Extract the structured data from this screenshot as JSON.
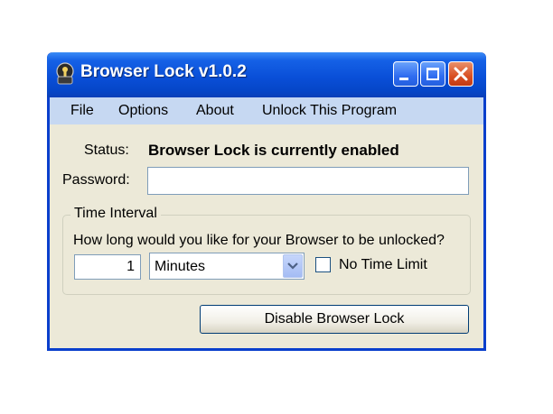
{
  "window": {
    "title": "Browser Lock v1.0.2",
    "icons": {
      "app": "lock-app-icon",
      "minimize": "minimize-icon",
      "maximize": "maximize-icon",
      "close": "close-icon"
    }
  },
  "menu": {
    "items": [
      {
        "label": "File"
      },
      {
        "label": "Options"
      },
      {
        "label": "About"
      },
      {
        "label": "Unlock This Program"
      }
    ]
  },
  "status": {
    "label": "Status:",
    "value": "Browser Lock is currently enabled"
  },
  "password": {
    "label": "Password:",
    "value": ""
  },
  "time_interval": {
    "legend": "Time Interval",
    "question": "How long would you like for your Browser to be unlocked?",
    "amount": "1",
    "unit": "Minutes",
    "unit_icon": "chevron-down-icon",
    "no_limit_label": "No Time Limit",
    "no_limit_checked": false
  },
  "actions": {
    "disable_label": "Disable Browser Lock"
  },
  "colors": {
    "titlebar": "#0a4fd8",
    "menubar": "#c6d8f2",
    "window_bg": "#ece9d8",
    "close_button": "#d94f22"
  }
}
